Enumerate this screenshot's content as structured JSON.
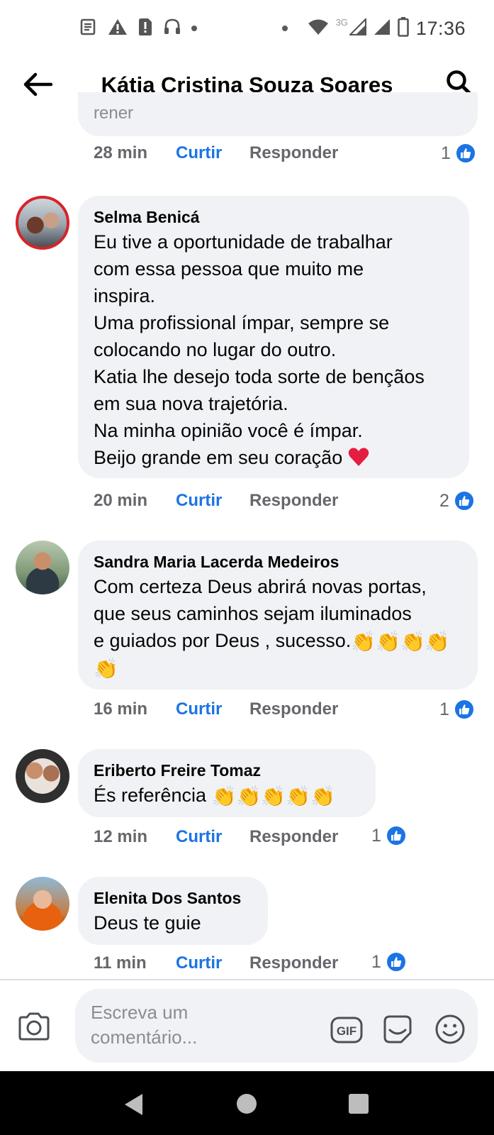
{
  "status_bar": {
    "time": "17:36",
    "network": "3G",
    "left_icons": [
      "news-icon",
      "warning-icon",
      "alert-sim-icon",
      "headset-icon",
      "dot-icon"
    ],
    "right_icons": [
      "dot-icon",
      "wifi-icon",
      "signal-icon",
      "signal-icon",
      "battery-icon"
    ]
  },
  "header": {
    "title": "Kátia Cristina Souza Soares",
    "back_icon": "back-arrow-icon",
    "search_icon": "search-icon"
  },
  "top_comment": {
    "fragment": "rener",
    "time": "28 min",
    "like_label": "Curtir",
    "reply_label": "Responder",
    "reaction_count": "1"
  },
  "comments": [
    {
      "author": "Selma Benicá",
      "text": "Eu tive a oportunidade de trabalhar\ncom essa pessoa que muito me\ninspira.\nUma profissional ímpar, sempre se\ncolocando no lugar do outro.\nKatia lhe desejo toda sorte de bençãos\nem sua nova trajetória.\nNa minha opinião você é ímpar.\nBeijo grande em seu coração",
      "time": "20 min",
      "like_label": "Curtir",
      "reply_label": "Responder",
      "reaction_count": "2",
      "emoji": "red-heart-icon"
    },
    {
      "author": "Sandra Maria Lacerda Medeiros",
      "text": "Com certeza Deus abrirá novas portas,\nque seus caminhos sejam iluminados\ne guiados por Deus , sucesso.",
      "time": "16 min",
      "like_label": "Curtir",
      "reply_label": "Responder",
      "reaction_count": "1",
      "emoji": "clapping-hands-icon"
    },
    {
      "author": "Eriberto Freire Tomaz",
      "text": "És referência",
      "time": "12 min",
      "like_label": "Curtir",
      "reply_label": "Responder",
      "reaction_count": "1",
      "emoji": "clapping-hands-icon"
    },
    {
      "author": "Elenita Dos Santos",
      "text": "Deus te guie",
      "time": "11 min",
      "like_label": "Curtir",
      "reply_label": "Responder",
      "reaction_count": "1"
    }
  ],
  "composer": {
    "placeholder": "Escreva um comentário...",
    "camera_icon": "camera-icon",
    "gif_icon": "gif-icon",
    "sticker_icon": "sticker-icon",
    "emoji_icon": "smiley-icon"
  },
  "colors": {
    "accent": "#1b74e4",
    "bubble": "#f0f2f5",
    "secondary_text": "#65676b",
    "heart": "#e41e3f"
  }
}
